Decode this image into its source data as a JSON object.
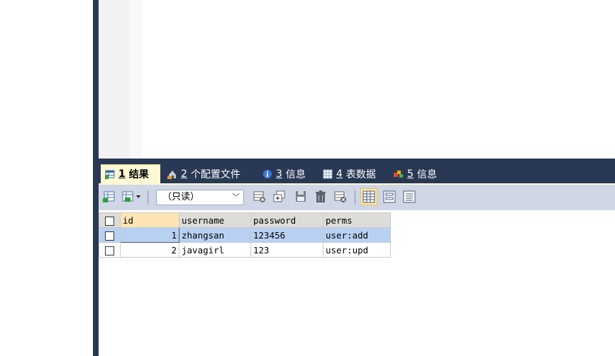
{
  "tabs": [
    {
      "num": "1",
      "label": "结果",
      "active": true
    },
    {
      "num": "2",
      "label": "个配置文件",
      "active": false
    },
    {
      "num": "3",
      "label": "信息",
      "active": false
    },
    {
      "num": "4",
      "label": "表数据",
      "active": false
    },
    {
      "num": "5",
      "label": "信息",
      "active": false
    }
  ],
  "toolbar": {
    "mode_label": "（只读）",
    "icons": [
      "export-icon",
      "import-icon",
      "add-row-icon",
      "duplicate-row-icon",
      "save-icon",
      "delete-icon",
      "cancel-icon",
      "grid-view-icon",
      "form-view-icon",
      "text-view-icon"
    ]
  },
  "grid": {
    "columns": [
      "id",
      "username",
      "password",
      "perms"
    ],
    "rows": [
      {
        "id": "1",
        "username": "zhangsan",
        "password": "123456",
        "perms": "user:add"
      },
      {
        "id": "2",
        "username": "javagirl",
        "password": "123",
        "perms": "user:upd"
      }
    ]
  },
  "colors": {
    "frame": "#293955",
    "active_tab": "#fef8d5",
    "toolbar": "#cfd6e5",
    "selected_row": "#b8d1f3"
  }
}
